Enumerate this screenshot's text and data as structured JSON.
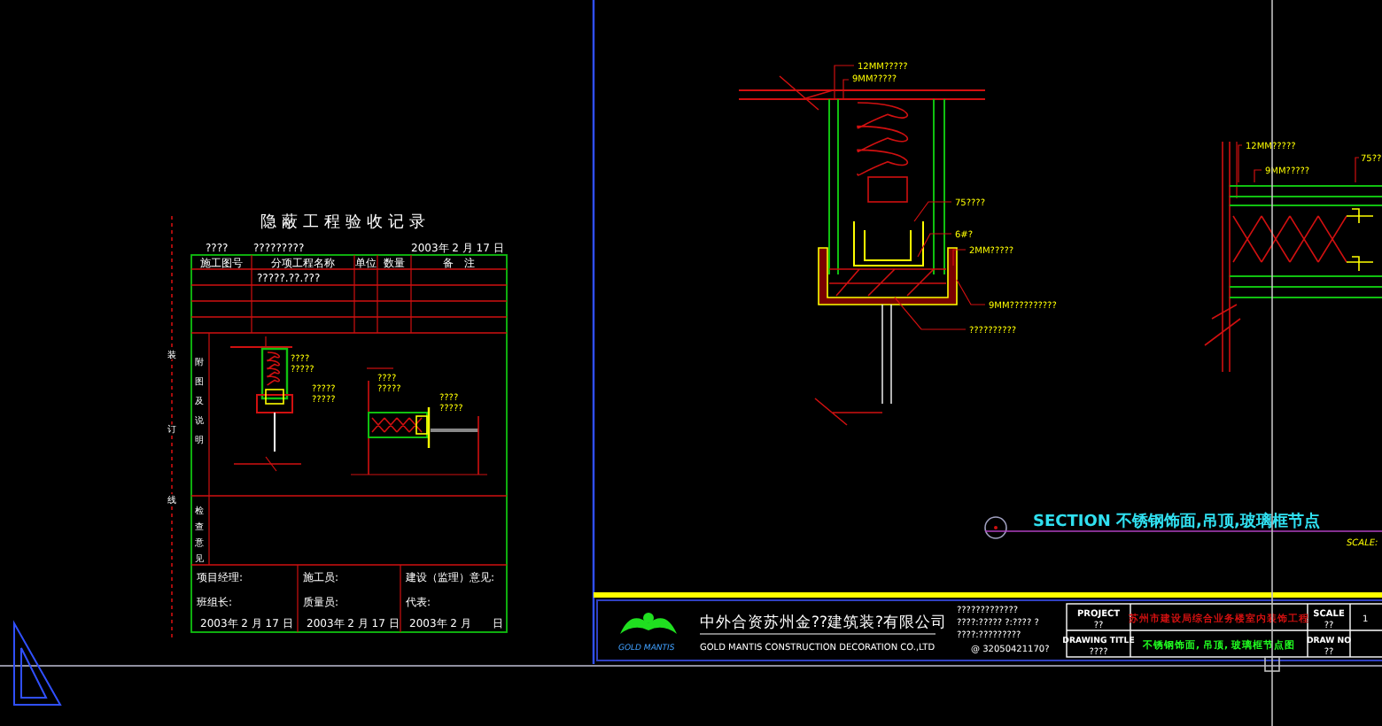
{
  "record_form": {
    "title": "隐蔽工程验收记录",
    "header_fields": [
      "????",
      "?????????",
      "2003年 2 月 17 日"
    ],
    "columns": [
      "施工图号",
      "分项工程名称",
      "单位",
      "数量",
      "备　注"
    ],
    "rows": [
      {
        "cells": [
          "",
          "?????.??.???",
          "",
          "",
          ""
        ]
      }
    ],
    "binding_marks": [
      "装",
      "订",
      "线"
    ],
    "side_labels": [
      "附图及说明",
      "检查意见"
    ],
    "detail_labels": [
      "????",
      "?????",
      "?????",
      "?????",
      "????",
      "?????",
      "????",
      "?????"
    ],
    "signatures": [
      {
        "role_1": "项目经理:",
        "role_2": "班组长:",
        "date": "2003年 2 月 17 日"
      },
      {
        "role_1": "施工员:",
        "role_2": "质量员:",
        "date": "2003年 2 月 17 日"
      },
      {
        "role_1": "建设（监理）意见:",
        "role_2": "代表:",
        "date": "2003年 2 月　　日"
      }
    ]
  },
  "section_drawing": {
    "labels": [
      "12MM?????",
      "9MM?????",
      "75????",
      "6#?",
      "2MM?????",
      "9MM??????????",
      "??????????"
    ]
  },
  "side_drawing": {
    "labels": [
      "12MM?????",
      "9MM?????",
      "75??"
    ]
  },
  "section_title": {
    "text": "SECTION 不锈钢饰面,吊顶,玻璃框节点",
    "scale": "SCALE:"
  },
  "title_block": {
    "logo_text": "GOLD MANTIS",
    "company": "中外合资苏州金??建筑装?有限公司",
    "company_en": "GOLD MANTIS CONSTRUCTION DECORATION CO.,LTD",
    "notes": [
      "?????????????",
      "????:?????  ?:????  ?",
      "????:?????????",
      "@ 32050421170?"
    ],
    "project_label": "PROJECT",
    "project_value": "??",
    "project_name": "苏州市建设局综合业务楼室内装饰工程",
    "scale_label": "SCALE",
    "scale_value": "??",
    "scale_next": "1",
    "drawing_title_label": "DRAWING TITLE",
    "drawing_title_value": "????",
    "drawing_title": "不锈钢饰面, 吊顶, 玻璃框节点图",
    "draw_no_label": "DRAW NO",
    "draw_no_value": "??"
  }
}
